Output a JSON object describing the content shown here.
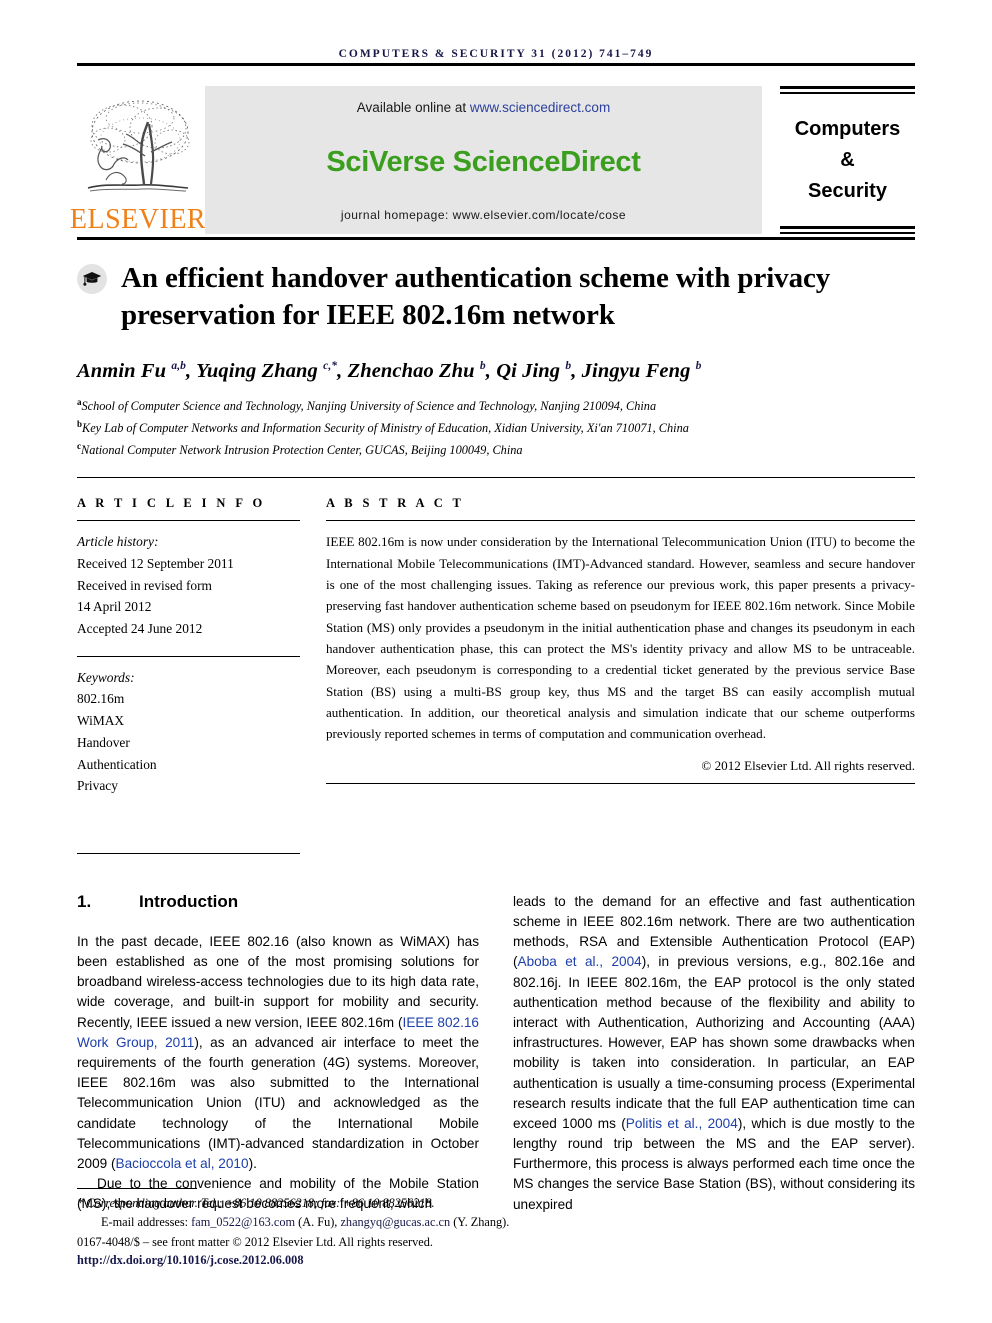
{
  "running_head": "Computers & Security 31 (2012) 741–749",
  "masthead": {
    "publisher_wordmark": "ELSEVIER",
    "available_prefix": "Available online at ",
    "available_url": "www.sciencedirect.com",
    "platform_title": "SciVerse ScienceDirect",
    "journal_homepage": "journal homepage: www.elsevier.com/locate/cose",
    "journal_name_line1": "Computers",
    "journal_name_line2": "&",
    "journal_name_line3": "Security",
    "banner_bg": "#e6e6e6",
    "platform_title_color": "#3b9e1f",
    "wordmark_color": "#f08019",
    "url_color": "#2b3f9e"
  },
  "article": {
    "title": "An efficient handover authentication scheme with privacy preservation for IEEE 802.16m network",
    "authors_html": "Anmin Fu <sup>a,b</sup>, Yuqing Zhang <sup>c,*</sup>, Zhenchao Zhu <sup>b</sup>, Qi Jing <sup>b</sup>, Jingyu Feng <sup>b</sup>",
    "affiliations": [
      {
        "marker": "a",
        "text": "School of Computer Science and Technology, Nanjing University of Science and Technology, Nanjing 210094, China"
      },
      {
        "marker": "b",
        "text": "Key Lab of Computer Networks and Information Security of Ministry of Education, Xidian University, Xi'an 710071, China"
      },
      {
        "marker": "c",
        "text": "National Computer Network Intrusion Protection Center, GUCAS, Beijing 100049, China"
      }
    ]
  },
  "article_info": {
    "heading": "A R T I C L E  I N F O",
    "history_label": "Article history:",
    "history_lines": [
      "Received 12 September 2011",
      "Received in revised form",
      "14 April 2012",
      "Accepted 24 June 2012"
    ],
    "keywords_label": "Keywords:",
    "keywords": [
      "802.16m",
      "WiMAX",
      "Handover",
      "Authentication",
      "Privacy"
    ]
  },
  "abstract": {
    "heading": "A B S T R A C T",
    "text": "IEEE 802.16m is now under consideration by the International Telecommunication Union (ITU) to become the International Mobile Telecommunications (IMT)-Advanced standard. However, seamless and secure handover is one of the most challenging issues. Taking as reference our previous work, this paper presents a privacy-preserving fast handover authentication scheme based on pseudonym for IEEE 802.16m network. Since Mobile Station (MS) only provides a pseudonym in the initial authentication phase and changes its pseudonym in each handover authentication phase, this can protect the MS's identity privacy and allow MS to be untraceable. Moreover, each pseudonym is corresponding to a credential ticket generated by the previous service Base Station (BS) using a multi-BS group key, thus MS and the target BS can easily accomplish mutual authentication. In addition, our theoretical analysis and simulation indicate that our scheme outperforms previously reported schemes in terms of computation and communication overhead.",
    "copyright": "© 2012 Elsevier Ltd. All rights reserved."
  },
  "body": {
    "section_number": "1.",
    "section_title": "Introduction",
    "left_paragraphs": [
      "In the past decade, IEEE 802.16 (also known as WiMAX) has been established as one of the most promising solutions for broadband wireless-access technologies due to its high data rate, wide coverage, and built-in support for mobility and security. Recently, IEEE issued a new version, IEEE 802.16m (IEEE 802.16 Work Group, 2011), as an advanced air interface to meet the requirements of the fourth generation (4G) systems. Moreover, IEEE 802.16m was also submitted to the International Telecommunication Union (ITU) and acknowledged as the candidate technology of the International Mobile Telecommunications (IMT)-advanced standardization in October 2009 (Bacioccola et al, 2010).",
      "Due to the convenience and mobility of the Mobile Station (MS), the handover request becomes more frequent, which"
    ],
    "left_citations": [
      "IEEE 802.16 Work Group, 2011",
      "Bacioccola et al, 2010"
    ],
    "right_paragraphs": [
      "leads to the demand for an effective and fast authentication scheme in IEEE 802.16m network. There are two authentication methods, RSA and Extensible Authentication Protocol (EAP) (Aboba et al., 2004), in previous versions, e.g., 802.16e and 802.16j. In IEEE 802.16m, the EAP protocol is the only stated authentication method because of the flexibility and ability to interact with Authentication, Authorizing and Accounting (AAA) infrastructures. However, EAP has shown some drawbacks when mobility is taken into consideration. In particular, an EAP authentication is usually a time-consuming process (Experimental research results indicate that the full EAP authentication time can exceed 1000 ms (Politis et al., 2004), which is due mostly to the lengthy round trip between the MS and the EAP server). Furthermore, this process is always performed each time once the MS changes the service Base Station (BS), without considering its unexpired"
    ],
    "right_citations": [
      "Aboba et al., 2004",
      "Politis et al., 2004"
    ]
  },
  "footnotes": {
    "corresponding": "* Corresponding author. Tel.: +86 10 88256218; fax: +86 10 88256218.",
    "email_label": "E-mail addresses: ",
    "email1": "fam_0522@163.com",
    "email1_name": " (A. Fu), ",
    "email2": "zhangyq@gucas.ac.cn",
    "email2_name": " (Y. Zhang).",
    "issn_line": "0167-4048/$ – see front matter © 2012 Elsevier Ltd. All rights reserved.",
    "doi": "http://dx.doi.org/10.1016/j.cose.2012.06.008"
  }
}
